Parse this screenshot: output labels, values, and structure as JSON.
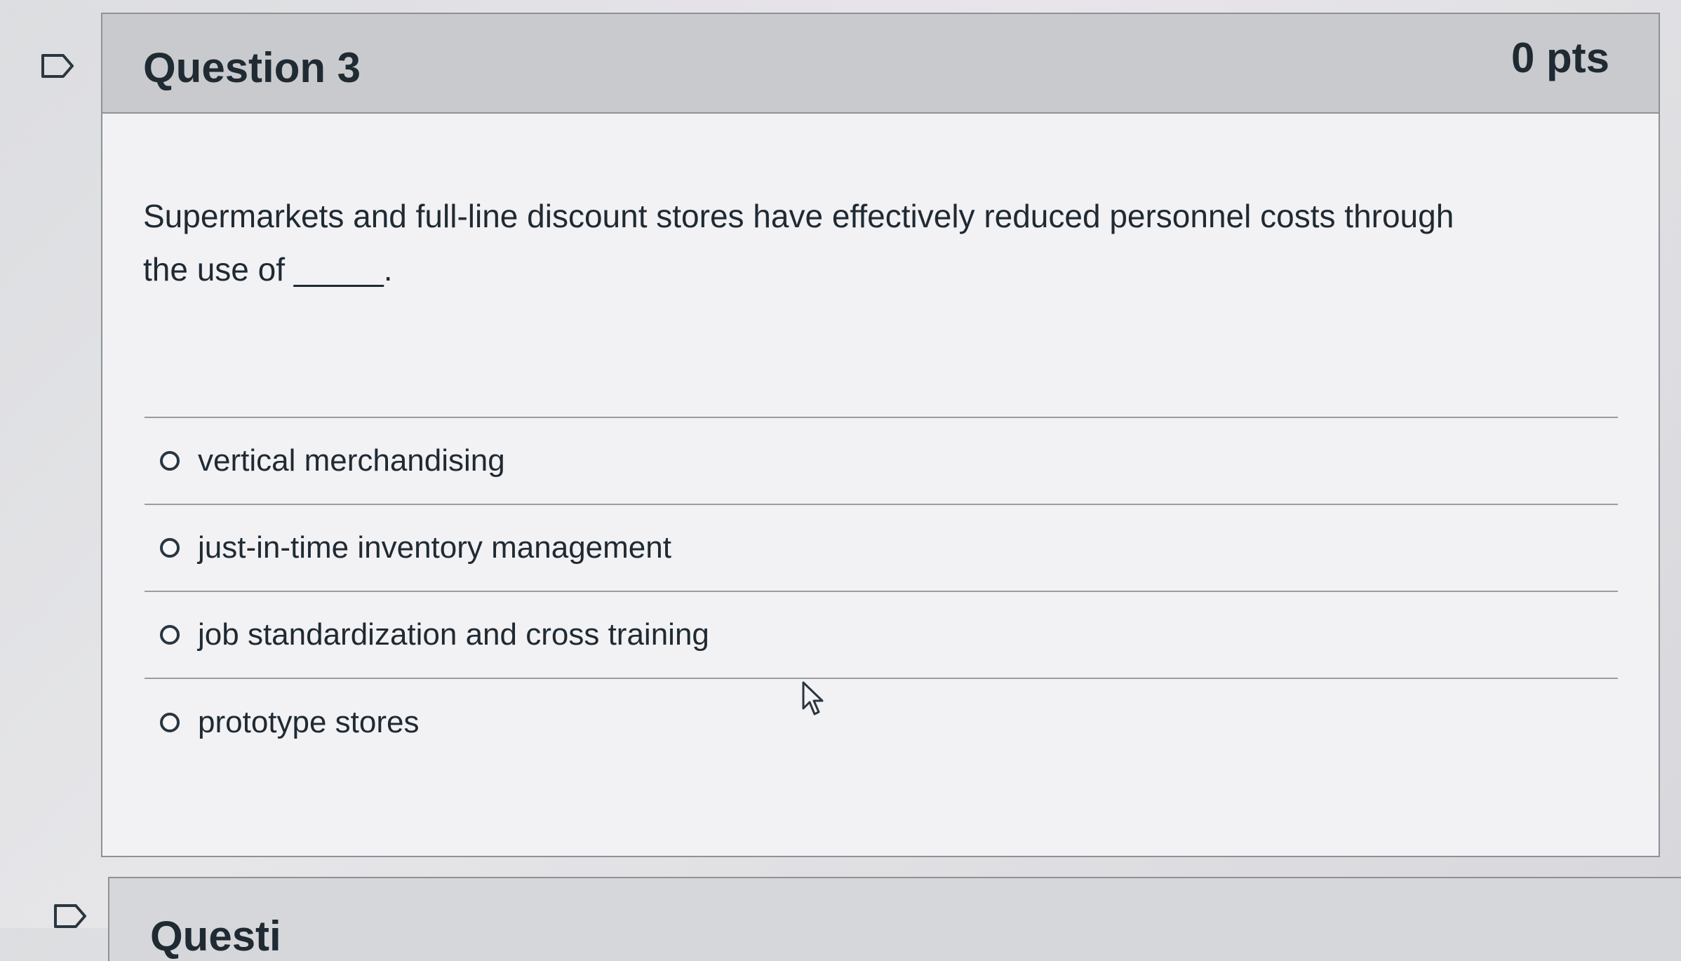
{
  "question": {
    "flag_icon": "flag-outline-icon",
    "title": "Question 3",
    "points": "0 pts",
    "text_line_1": "Supermarkets and full-line discount stores have effectively reduced personnel costs through",
    "text_line_2": "the use of _____.",
    "answers": [
      {
        "label": "vertical merchandising",
        "selected": false
      },
      {
        "label": "just-in-time inventory management",
        "selected": false
      },
      {
        "label": "job standardization and cross training",
        "selected": false
      },
      {
        "label": "prototype stores",
        "selected": false
      }
    ]
  },
  "next_question": {
    "flag_icon": "flag-outline-icon",
    "title_partial": "Questi"
  },
  "colors": {
    "header_bg": "#c9cacd",
    "card_bg": "#f2f1f4",
    "text": "#1f2a33",
    "border": "#8e9195"
  }
}
